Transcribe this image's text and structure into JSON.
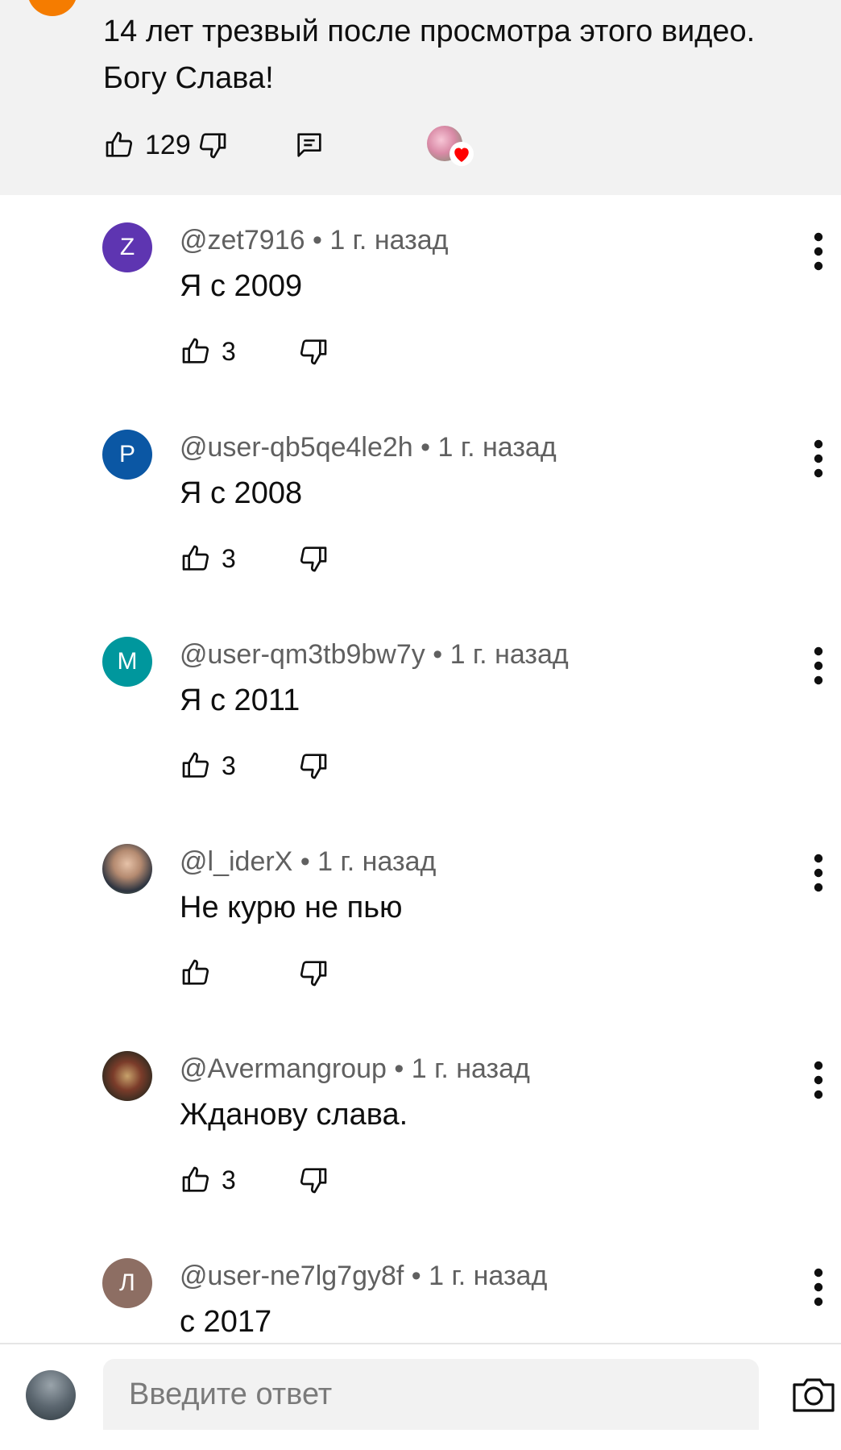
{
  "parent_comment": {
    "text_line1": "14 лет трезвый после просмотра этого видео.",
    "text_line2": "Богу Слава!",
    "likes": "129",
    "icons": [
      "like-icon",
      "dislike-icon",
      "reply-icon",
      "creator-heart-icon"
    ],
    "avatar_color": "#f57c00"
  },
  "replies": [
    {
      "author": "@zet7916",
      "time": "1 г. назад",
      "text": "Я с 2009",
      "likes": "3",
      "avatar_letter": "Z",
      "avatar_color": "#5e35b1"
    },
    {
      "author": "@user-qb5qe4le2h",
      "time": "1 г. назад",
      "text": "Я с 2008",
      "likes": "3",
      "avatar_letter": "P",
      "avatar_color": "#0b57a4"
    },
    {
      "author": "@user-qm3tb9bw7y",
      "time": "1 г. назад",
      "text": "Я с 2011",
      "likes": "3",
      "avatar_letter": "M",
      "avatar_color": "#00979d"
    },
    {
      "author": "@l_iderX",
      "time": "1 г. назад",
      "text": "Не курю не пью",
      "likes": "",
      "avatar_letter": "",
      "avatar_color": "photo"
    },
    {
      "author": "@Avermangroup",
      "time": "1 г. назад",
      "text": "Жданову слава.",
      "likes": "3",
      "avatar_letter": "",
      "avatar_color": "photo"
    },
    {
      "author": "@user-ne7lg7gy8f",
      "time": "1 г. назад",
      "text": "с 2017",
      "likes": "",
      "avatar_letter": "Л",
      "avatar_color": "#8d6e63"
    }
  ],
  "separator": "•",
  "reply_box": {
    "placeholder": "Введите ответ",
    "camera_icon": "camera-icon"
  },
  "colors": {
    "meta_text": "#606060",
    "body_text": "#0f0f0f",
    "parent_bg": "#f2f2f2"
  }
}
